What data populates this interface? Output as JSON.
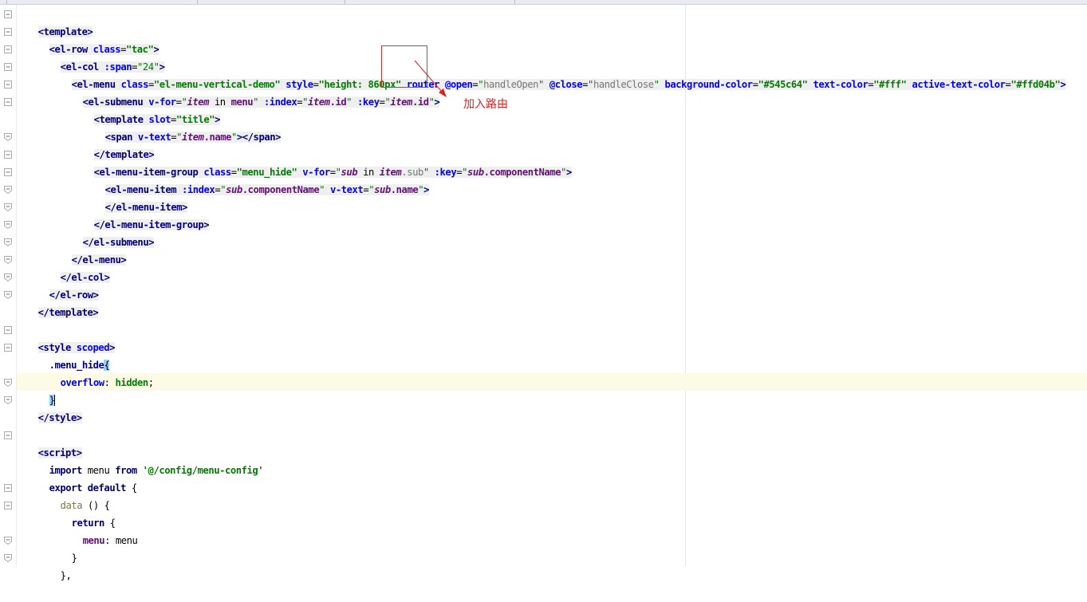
{
  "annotation": {
    "label": "加入路由",
    "color": "#e02020"
  },
  "code": {
    "l1_tag": "<template>",
    "l2_open": "<el-row ",
    "l2_attr": "class",
    "l2_val": "\"tac\"",
    "l2_close": ">",
    "l3_open": "<el-col ",
    "l3_attr": ":span",
    "l3_val": "\"24\"",
    "l3_close": ">",
    "l4_open": "<el-menu ",
    "l4_a1": "class",
    "l4_v1": "\"el-menu-vertical-demo\"",
    "l4_a2": "style",
    "l4_v2": "\"height: 860px\"",
    "l4_a3": "router",
    "l4_a4": "@open",
    "l4_v4": "handleOpen",
    "l4_a5": "@close",
    "l4_v5": "handleClose",
    "l4_a6": "background-color",
    "l4_v6": "\"#545c64\"",
    "l4_a7": "text-color",
    "l4_v7": "\"#fff\"",
    "l4_a8": "active-text-color",
    "l4_v8": "\"#ffd04b\"",
    "l4_close": ">",
    "l5_open": "<el-submenu ",
    "l5_a1": "v-for",
    "l5_i1": "item",
    "l5_in": " in ",
    "l5_p1": "menu",
    "l5_a2": ":index",
    "l5_i2": "item",
    "l5_p2": ".id",
    "l5_a3": ":key",
    "l5_i3": "item",
    "l5_p3": ".id",
    "l5_close": ">",
    "l6_open": "<template ",
    "l6_attr": "slot",
    "l6_val": "\"title\"",
    "l6_close": ">",
    "l7_open": "<span ",
    "l7_attr": "v-text",
    "l7_i": "item",
    "l7_p": ".name",
    "l7_close": "></span>",
    "l8_tag": "</template>",
    "l9_open": "<el-menu-item-group ",
    "l9_a1": "class",
    "l9_v1": "\"menu_hide\"",
    "l9_a2": "v-for",
    "l9_i1": "sub",
    "l9_in": " in ",
    "l9_i2": "item",
    "l9_p2": ".sub",
    "l9_a3": ":key",
    "l9_i3": "sub",
    "l9_p3": ".componentName",
    "l9_close": ">",
    "l10_open": "<el-menu-item ",
    "l10_a1": ":index",
    "l10_i1": "sub",
    "l10_p1": ".componentName",
    "l10_a2": "v-text",
    "l10_i2": "sub",
    "l10_p2": ".name",
    "l10_close": ">",
    "l11_tag": "</el-menu-item>",
    "l12_tag": "</el-menu-item-group>",
    "l13_tag": "</el-submenu>",
    "l14_tag": "</el-menu>",
    "l15_tag": "</el-col>",
    "l16_tag": "</el-row>",
    "l17_tag": "</template>",
    "l19_open": "<style ",
    "l19_attr": "scoped",
    "l19_close": ">",
    "l20_sel": ".menu_hide",
    "l20_brace": "{",
    "l21_prop": "overflow",
    "l21_colon": ": ",
    "l21_val": "hidden",
    "l21_semi": ";",
    "l22_brace": "}",
    "l23_tag": "</style>",
    "l25_tag": "<script>",
    "l26_kw1": "import",
    "l26_id": " menu ",
    "l26_kw2": "from",
    "l26_str": "'@/config/menu-config'",
    "l27_kw1": "export default",
    "l27_rest": " {",
    "l28_fn": "data",
    "l28_rest": " () {",
    "l29_kw": "return",
    "l29_rest": " {",
    "l30_key": "menu",
    "l30_rest": ": menu",
    "l31_text": "}",
    "l32_text": "},"
  }
}
